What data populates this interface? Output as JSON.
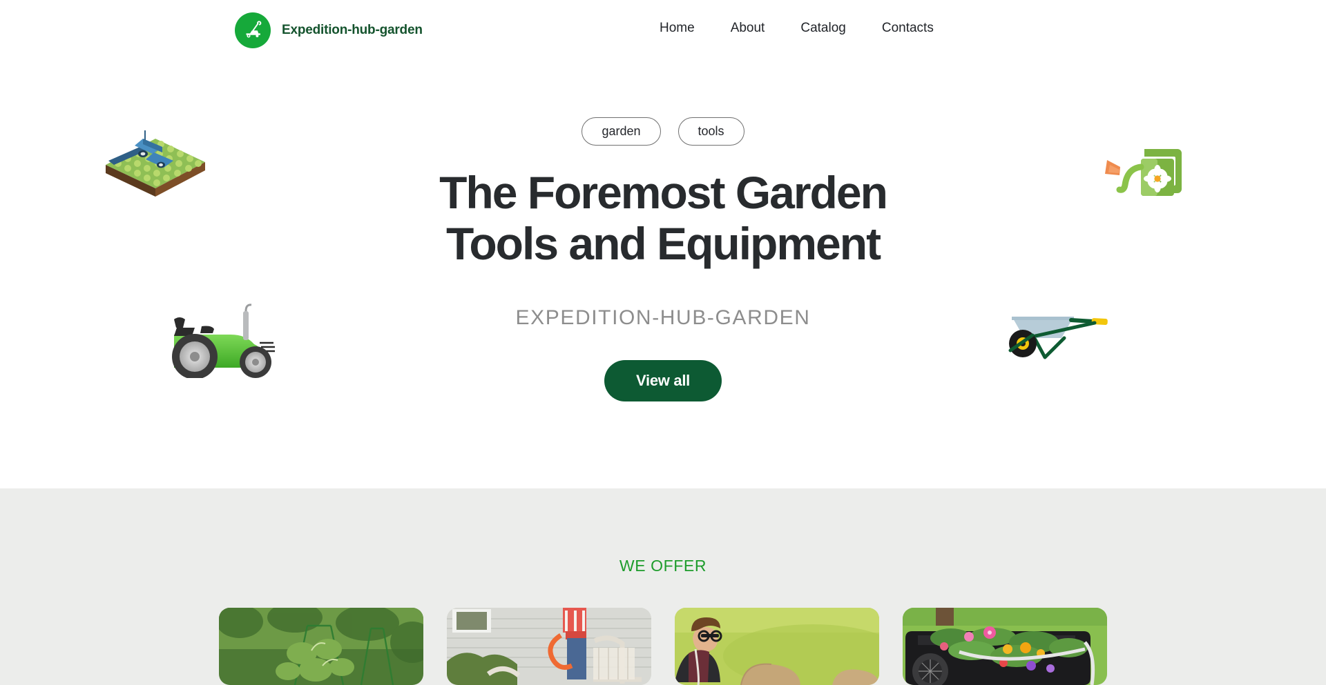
{
  "header": {
    "brand_name": "Expedition-hub-garden",
    "logo_icon": "lawnmower-icon",
    "nav": [
      {
        "label": "Home"
      },
      {
        "label": "About"
      },
      {
        "label": "Catalog"
      },
      {
        "label": "Contacts"
      }
    ]
  },
  "hero": {
    "pills": [
      {
        "label": "garden"
      },
      {
        "label": "tools"
      }
    ],
    "headline_line1": "The Foremost Garden",
    "headline_line2": "Tools and Equipment",
    "subheadline": "EXPEDITION-HUB-GARDEN",
    "cta_label": "View all",
    "decorations": [
      {
        "name": "isometric-farm-field-illustration"
      },
      {
        "name": "watering-can-illustration"
      },
      {
        "name": "green-tractor-illustration"
      },
      {
        "name": "wheelbarrow-illustration"
      }
    ]
  },
  "offer": {
    "title": "WE OFFER",
    "cards": [
      {
        "name": "offer-card-garden-trellis-plants"
      },
      {
        "name": "offer-card-person-with-hose-and-cart"
      },
      {
        "name": "offer-card-man-on-lawn-with-soil-bags"
      },
      {
        "name": "offer-card-garden-cart-with-flowers"
      }
    ]
  },
  "colors": {
    "brand_green": "#16a93a",
    "brand_dark_green": "#14532d",
    "cta_green": "#0d5a33",
    "offer_title_green": "#1d9c2b",
    "offer_bg": "#ecedeb",
    "headline": "#282b2e",
    "subhead": "#8d8d8d"
  }
}
